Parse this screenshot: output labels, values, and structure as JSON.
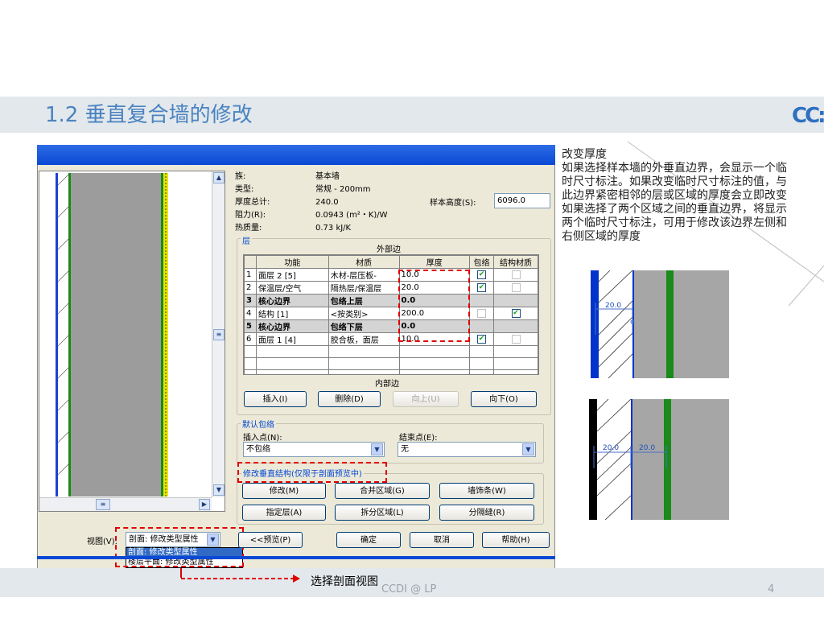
{
  "slide": {
    "title": "1.2 垂直复合墙的修改",
    "logo": "CC:",
    "footer": "CCDI @ LP",
    "page_number": "4",
    "annotation": "选择剖面视图"
  },
  "dialog": {
    "properties": [
      {
        "label": "族:",
        "value": "基本墙"
      },
      {
        "label": "类型:",
        "value": "常规 - 200mm"
      },
      {
        "label": "厚度总计:",
        "value": "240.0"
      },
      {
        "label": "阻力(R):",
        "value": "0.0943 (m²・K)/W"
      },
      {
        "label": "热质量:",
        "value": "0.73 kJ/K"
      }
    ],
    "sample_height_label": "样本高度(S):",
    "sample_height_value": "6096.0",
    "layers_group_label": "层",
    "exterior_side": "外部边",
    "interior_side": "内部边",
    "columns": [
      "功能",
      "材质",
      "厚度",
      "包络",
      "结构材质"
    ],
    "rows": [
      {
        "num": "1",
        "function": "面层 2 [5]",
        "material": "木材-层压板-",
        "thickness": "10.0",
        "wrap": true,
        "structural": false,
        "wrap_enabled": true,
        "struct_enabled": false,
        "boundary": false
      },
      {
        "num": "2",
        "function": "保温层/空气",
        "material": "隔热层/保温层",
        "thickness": "20.0",
        "wrap": true,
        "structural": false,
        "wrap_enabled": true,
        "struct_enabled": false,
        "boundary": false
      },
      {
        "num": "3",
        "function": "核心边界",
        "material": "包络上层",
        "thickness": "0.0",
        "boundary": true
      },
      {
        "num": "4",
        "function": "结构 [1]",
        "material": "<按类别>",
        "thickness": "200.0",
        "wrap": false,
        "structural": true,
        "wrap_enabled": false,
        "struct_enabled": true,
        "boundary": false
      },
      {
        "num": "5",
        "function": "核心边界",
        "material": "包络下层",
        "thickness": "0.0",
        "boundary": true
      },
      {
        "num": "6",
        "function": "面层 1 [4]",
        "material": "胶合板，面层",
        "thickness": "10.0",
        "wrap": true,
        "structural": false,
        "wrap_enabled": true,
        "struct_enabled": false,
        "boundary": false
      }
    ],
    "layer_buttons": {
      "insert": "插入(I)",
      "delete": "删除(D)",
      "up": "向上(U)",
      "down": "向下(O)"
    },
    "default_wrap_label": "默认包络",
    "insert_point_label": "插入点(N):",
    "insert_point_value": "不包络",
    "end_point_label": "结束点(E):",
    "end_point_value": "无",
    "modify_vertical_label": "修改垂直结构(仅限于剖面预览中)",
    "vertical_buttons": {
      "modify": "修改(M)",
      "merge": "合并区域(G)",
      "sweeps": "墙饰条(W)",
      "assign": "指定层(A)",
      "split": "拆分区域(L)",
      "reveals": "分隔缝(R)"
    },
    "view_label": "视图(V):",
    "view_value": "剖面: 修改类型属性",
    "view_options": [
      "剖面: 修改类型属性",
      "楼层平面: 修改类型属性"
    ],
    "bottom_buttons": {
      "preview": "<<预览(P)",
      "ok": "确定",
      "cancel": "取消",
      "help": "帮助(H)"
    }
  },
  "right_panel": {
    "lines": [
      "改变厚度",
      "如果选择样本墙的外垂直边界，会显示一个临",
      "时尺寸标注。如果改变临时尺寸标注的值，与",
      "此边界紧密相邻的层或区域的厚度会立即改变",
      "如果选择了两个区域之间的垂直边界，将显示",
      "两个临时尺寸标注，可用于修改该边界左侧和",
      "右侧区域的厚度"
    ],
    "figure1_dim": "20.0",
    "figure2_dims": [
      "20.0",
      "20.0"
    ]
  },
  "colors": {
    "title": "#4a83c1",
    "accent_red": "#e00000",
    "titlebar": "#0a49d5",
    "wall_blue": "#0033cc",
    "wall_green": "#1a8a1a"
  }
}
